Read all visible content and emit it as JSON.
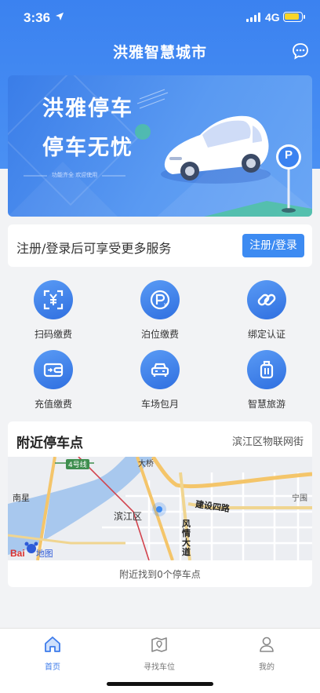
{
  "status_bar": {
    "time": "3:36",
    "network": "4G"
  },
  "header": {
    "title": "洪雅智慧城市",
    "chat_icon": "chat-bubble-icon"
  },
  "banner": {
    "line1": "洪雅停车",
    "line2": "停车无忧",
    "tagline": "功能齐全 欢迎使用",
    "sign_letter": "P"
  },
  "login": {
    "prompt": "注册/登录后可享受更多服务",
    "button_label": "注册/登录",
    "accent": "#3d8bf2"
  },
  "services": [
    {
      "label": "扫码缴费",
      "icon": "scan-yuan-icon"
    },
    {
      "label": "泊位缴费",
      "icon": "parking-yuan-icon"
    },
    {
      "label": "绑定认证",
      "icon": "link-icon"
    },
    {
      "label": "充值缴费",
      "icon": "wallet-icon"
    },
    {
      "label": "车场包月",
      "icon": "car-icon"
    },
    {
      "label": "智慧旅游",
      "icon": "luggage-icon"
    }
  ],
  "nearby": {
    "title": "附近停车点",
    "location": "滨江区物联网街",
    "found_text": "附近找到0个停车点",
    "map_labels": {
      "district": "滨江区",
      "road": "建设四路",
      "avenue": "风情大道",
      "west": "南星",
      "east": "宁围",
      "metro": "4号线",
      "bridge": "大桥",
      "logo_bai": "Bai",
      "logo_map": "地图"
    }
  },
  "tabs": [
    {
      "label": "首页",
      "icon": "home-icon",
      "active": true
    },
    {
      "label": "寻找车位",
      "icon": "map-pin-icon",
      "active": false
    },
    {
      "label": "我的",
      "icon": "user-icon",
      "active": false
    }
  ],
  "colors": {
    "primary": "#3b82f0",
    "tab_active": "#3d7bea"
  }
}
